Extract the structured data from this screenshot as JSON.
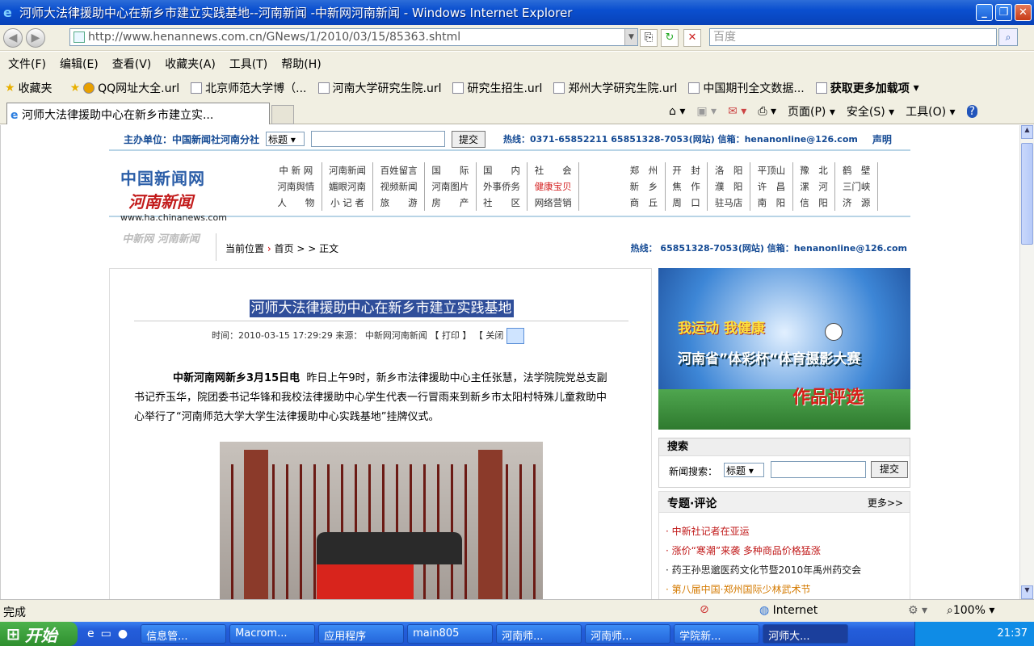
{
  "window": {
    "title": "河师大法律援助中心在新乡市建立实践基地--河南新闻 -中新网河南新闻 - Windows Internet Explorer"
  },
  "browser": {
    "address": "http://www.henannews.com.cn/GNews/1/2010/03/15/85363.shtml",
    "search_placeholder": "百度",
    "menu": [
      "文件(F)",
      "编辑(E)",
      "查看(V)",
      "收藏夹(A)",
      "工具(T)",
      "帮助(H)"
    ],
    "favorites_label": "收藏夹",
    "favorites": [
      "QQ网址大全.url",
      "北京师范大学博（...",
      "河南大学研究生院.url",
      "研究生招生.url",
      "郑州大学研究生院.url",
      "中国期刊全文数据...",
      "获取更多加载项"
    ],
    "tab_title": "河师大法律援助中心在新乡市建立实...",
    "tools": [
      "页面(P)",
      "安全(S)",
      "工具(O)"
    ],
    "status": "完成",
    "zone": "Internet",
    "zoom": "100%"
  },
  "page": {
    "top": {
      "host": "主办单位：中国新闻社河南分社",
      "select": "标题",
      "submit": "提交",
      "hotline": "热线：0371-65852211 65851328-7053(网站) 信箱：henanonline@126.com",
      "statement": "声明"
    },
    "logo": {
      "line1": "中国新闻网",
      "line2": "河南新闻",
      "url": "www.ha.chinanews.com"
    },
    "nav_left": [
      [
        "中 新 网",
        "河南新闻",
        "百姓留言",
        "国　　际",
        "国　　内",
        "社　　会"
      ],
      [
        "河南舆情",
        "媚眼河南",
        "视频新闻",
        "河南图片",
        "外事侨务",
        "健康宝贝"
      ],
      [
        "人　　物",
        "小 记 者",
        "旅　　游",
        "房　　产",
        "社　　区",
        "网络营销"
      ]
    ],
    "nav_right": [
      [
        "郑　州",
        "开　封",
        "洛　阳",
        "平顶山",
        "豫　北",
        "鹤　壁"
      ],
      [
        "新　乡",
        "焦　作",
        "濮　阳",
        "许　昌",
        "漯　河",
        "三门峡"
      ],
      [
        "商　丘",
        "周　口",
        "驻马店",
        "南　阳",
        "信　阳",
        "济　源"
      ]
    ],
    "breadcrumb": {
      "label": "当前位置",
      "sep": "›",
      "home": "首页",
      "arrows": "> >",
      "current": "正文"
    },
    "side_logo": "中新网 河南新闻",
    "hotline2": "热线： 65851328-7053(网站) 信箱：henanonline@126.com",
    "article": {
      "title": "河师大法律援助中心在新乡市建立实践基地",
      "meta_time": "时间：2010-03-15 17:29:29",
      "meta_source": "来源： 中新网河南新闻",
      "print": "【 打印 】",
      "close": "【 关闭",
      "lead": "中新河南网新乡3月15日电",
      "body": "昨日上午9时，新乡市法律援助中心主任张慧，法学院院党总支副书记乔玉华，院团委书记华锋和我校法律援助中心学生代表一行冒雨来到新乡市太阳村特殊儿童救助中心举行了“河南师范大学大学生法律援助中心实践基地”挂牌仪式。"
    },
    "ad": {
      "line1": "我运动 我健康",
      "line2": "河南省”体彩杯“体育摄影大赛",
      "line3": "作品评选"
    },
    "search_box": {
      "title": "搜索",
      "label": "新闻搜索：",
      "select": "标题",
      "submit": "提交"
    },
    "topics": {
      "title": "专题·评论",
      "more": "更多>>",
      "items": [
        "中新社记者在亚运",
        "涨价“寒潮”来袭 多种商品价格猛涨",
        "药王孙思邈医药文化节暨2010年禹州药交会",
        "第八届中国·郑州国际少林武术节"
      ]
    }
  },
  "taskbar": {
    "start": "开始",
    "items": [
      "信息管...",
      "Macrom...",
      "应用程序",
      "main805",
      "河南师...",
      "河南师...",
      "学院新...",
      "河师大..."
    ],
    "clock": "21:37"
  }
}
